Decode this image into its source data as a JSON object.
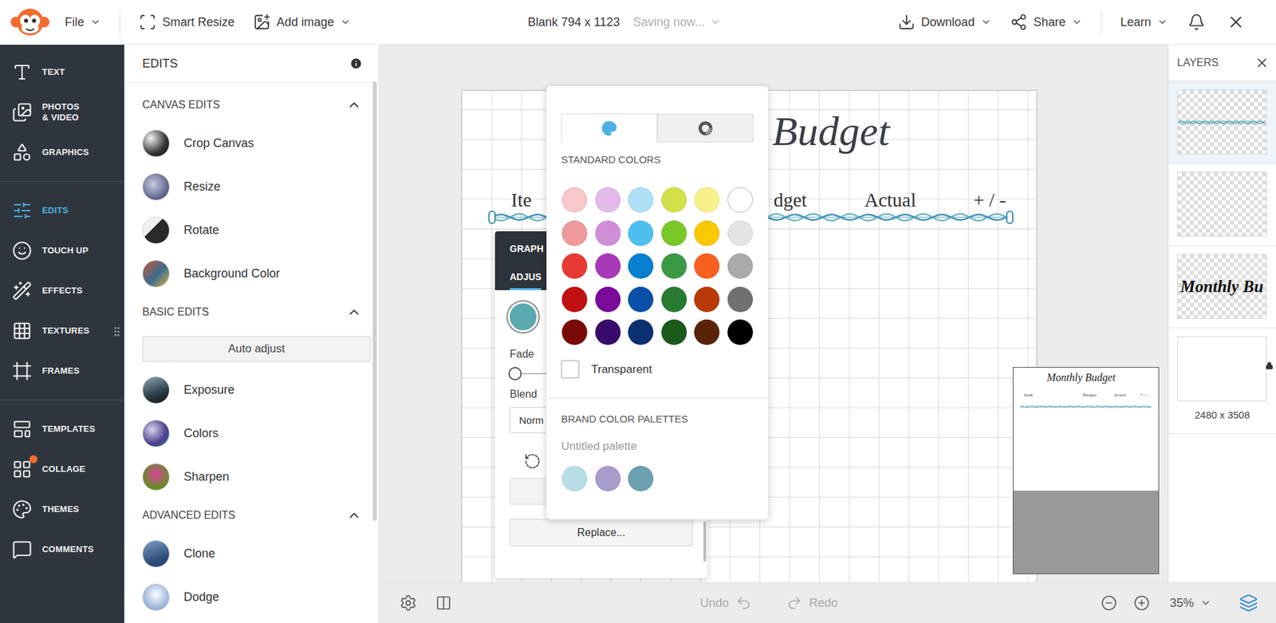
{
  "topbar": {
    "left": [
      {
        "label": "File",
        "dropdown": true
      },
      {
        "label": "Smart Resize",
        "dropdown": false
      },
      {
        "label": "Add image",
        "dropdown": true
      }
    ],
    "title": "Blank 794 x 1123",
    "status": "Saving now...",
    "right": [
      {
        "label": "Download",
        "dropdown": true
      },
      {
        "label": "Share",
        "dropdown": true
      },
      {
        "label": "Learn",
        "dropdown": true
      }
    ]
  },
  "nav": {
    "groups": [
      {
        "items": [
          {
            "label": "TEXT",
            "selected": false,
            "badge": false
          },
          {
            "label": "PHOTOS\n& VIDEO",
            "selected": false,
            "badge": false
          },
          {
            "label": "GRAPHICS",
            "selected": false,
            "badge": false
          }
        ]
      },
      {
        "items": [
          {
            "label": "EDITS",
            "selected": true,
            "badge": false
          },
          {
            "label": "TOUCH UP",
            "selected": false,
            "badge": false
          },
          {
            "label": "EFFECTS",
            "selected": false,
            "badge": false
          },
          {
            "label": "TEXTURES",
            "selected": false,
            "badge": false
          },
          {
            "label": "FRAMES",
            "selected": false,
            "badge": false
          }
        ]
      },
      {
        "items": [
          {
            "label": "TEMPLATES",
            "selected": false,
            "badge": false
          },
          {
            "label": "COLLAGE",
            "selected": false,
            "badge": true
          },
          {
            "label": "THEMES",
            "selected": false,
            "badge": false
          },
          {
            "label": "COMMENTS",
            "selected": false,
            "badge": false
          }
        ]
      }
    ]
  },
  "edits_panel": {
    "title": "EDITS",
    "sections": [
      {
        "title": "CANVAS EDITS",
        "expanded": true,
        "items": [
          "Crop Canvas",
          "Resize",
          "Rotate",
          "Background Color"
        ]
      },
      {
        "title": "BASIC EDITS",
        "expanded": true,
        "button": "Auto adjust",
        "items": [
          "Exposure",
          "Colors",
          "Sharpen"
        ]
      },
      {
        "title": "ADVANCED EDITS",
        "expanded": true,
        "items": [
          "Clone",
          "Dodge"
        ]
      }
    ]
  },
  "canvas": {
    "title": "Budget",
    "headers": [
      "Ite",
      "dget",
      "Actual",
      "+ / -"
    ]
  },
  "graphic_panel": {
    "title": "GRAPH",
    "tab": "ADJUS",
    "color": "#5aaab0",
    "fade_label": "Fade",
    "fade": {
      "level": 0
    },
    "blend_label": "Blend",
    "blend_value": "Norm",
    "replace": "Replace..."
  },
  "color_picker": {
    "tabs": [
      {
        "kind": "palette",
        "selected": true
      },
      {
        "kind": "picker",
        "selected": false
      }
    ],
    "standard_title": "STANDARD COLORS",
    "standard": [
      {
        "color": "#f8c8cc",
        "selected": false
      },
      {
        "color": "#e2bbe8",
        "selected": false
      },
      {
        "color": "#aee0f8",
        "selected": false
      },
      {
        "color": "#d4e04a",
        "selected": false
      },
      {
        "color": "#f8f08a",
        "selected": false
      },
      {
        "color": "#ffffff",
        "selected": false
      },
      {
        "color": "#ee9a9a",
        "selected": false
      },
      {
        "color": "#d08ed8",
        "selected": false
      },
      {
        "color": "#4ec0f0",
        "selected": false
      },
      {
        "color": "#7ac828",
        "selected": false
      },
      {
        "color": "#f8c800",
        "selected": false
      },
      {
        "color": "#e4e4e4",
        "selected": false
      },
      {
        "color": "#e63a32",
        "selected": false
      },
      {
        "color": "#a83ab8",
        "selected": false
      },
      {
        "color": "#0a7ed0",
        "selected": false
      },
      {
        "color": "#3a9a44",
        "selected": false
      },
      {
        "color": "#f86020",
        "selected": false
      },
      {
        "color": "#aaaaaa",
        "selected": false
      },
      {
        "color": "#c01010",
        "selected": false
      },
      {
        "color": "#7a0a9a",
        "selected": false
      },
      {
        "color": "#0a50a8",
        "selected": false
      },
      {
        "color": "#287a30",
        "selected": false
      },
      {
        "color": "#b83a08",
        "selected": false
      },
      {
        "color": "#707070",
        "selected": false
      },
      {
        "color": "#7a0a08",
        "selected": false
      },
      {
        "color": "#3a0a6a",
        "selected": false
      },
      {
        "color": "#0a3070",
        "selected": false
      },
      {
        "color": "#1a5a1a",
        "selected": false
      },
      {
        "color": "#5a2208",
        "selected": false
      },
      {
        "color": "#000000",
        "selected": false
      }
    ],
    "transparent": {
      "label": "Transparent",
      "checked": false
    },
    "brand_title": "BRAND COLOR PALETTES",
    "palette_name": "Untitled palette",
    "brand": [
      {
        "color": "#b8dde6",
        "selected": false
      },
      {
        "color": "#a89ccc",
        "selected": false
      },
      {
        "color": "#6aa0b0",
        "selected": false
      }
    ]
  },
  "navigator": {
    "title": "Monthly Budget",
    "headers": [
      "Item",
      "Budget",
      "Actual",
      "+ / -"
    ]
  },
  "layers": {
    "title": "LAYERS",
    "items": [
      {
        "kind": "wave",
        "selected": true,
        "locked": false
      },
      {
        "kind": "empty",
        "selected": false,
        "locked": false
      },
      {
        "kind": "text",
        "text": "Monthly Bu",
        "selected": false,
        "locked": false
      },
      {
        "kind": "background",
        "size": "2480 x 3508",
        "selected": false,
        "locked": true
      }
    ]
  },
  "bottom_bar": {
    "undo": {
      "label": "Undo",
      "disabled": true
    },
    "redo": {
      "label": "Redo",
      "disabled": true
    },
    "zoom": {
      "value": "35%",
      "dropdown": true
    }
  }
}
